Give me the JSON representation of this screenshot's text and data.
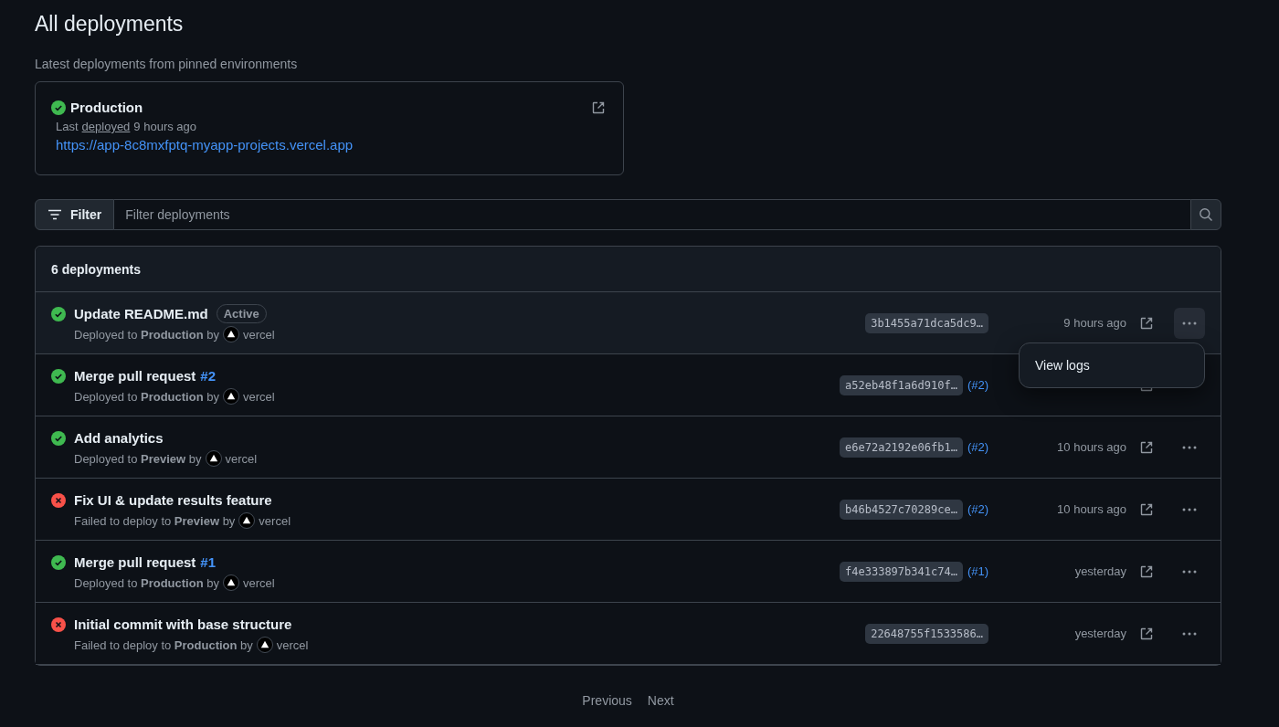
{
  "title": "All deployments",
  "pinned": {
    "heading": "Latest deployments from pinned environments",
    "environment": "Production",
    "kind": "success",
    "last_prefix": "Last",
    "last_link": "deployed",
    "last_time": "9 hours ago",
    "url": "https://app-8c8mxfptq-myapp-projects.vercel.app"
  },
  "filter": {
    "button": "Filter",
    "placeholder": "Filter deployments"
  },
  "list": {
    "count": "6 deployments",
    "rows": [
      {
        "kind": "success",
        "title": "Update README.md",
        "badge": "Active",
        "detail": "Deployed to **Production** by",
        "user": "vercel",
        "sha": "3b1455a71dca5dc9…",
        "time": "9 hours ago",
        "selected": true,
        "menu": [
          "View logs"
        ]
      },
      {
        "kind": "success",
        "title": "Merge pull request",
        "title_ref": "#2",
        "detail": "Deployed to **Production** by",
        "user": "vercel",
        "sha": "a52eb48f1a6d910f…",
        "pr": "(#2)",
        "selected": false,
        "menu": []
      },
      {
        "kind": "success",
        "title": "Add analytics",
        "detail": "Deployed to **Preview** by",
        "user": "vercel",
        "sha": "e6e72a2192e06fb1…",
        "pr": "(#2)",
        "time": "10 hours ago",
        "selected": false,
        "menu": []
      },
      {
        "kind": "failure",
        "title": "Fix UI & update results feature",
        "detail": "Failed to deploy to **Preview** by",
        "user": "vercel",
        "sha": "b46b4527c70289ce…",
        "pr": "(#2)",
        "time": "10 hours ago",
        "selected": false,
        "menu": []
      },
      {
        "kind": "success",
        "title": "Merge pull request",
        "title_ref": "#1",
        "detail": "Deployed to **Production** by",
        "user": "vercel",
        "sha": "f4e333897b341c74…",
        "pr": "(#1)",
        "time": "yesterday",
        "selected": false,
        "menu": []
      },
      {
        "kind": "failure",
        "title": "Initial commit with base structure",
        "detail": "Failed to deploy to **Production** by",
        "user": "vercel",
        "sha": "22648755f1533586…",
        "time": "yesterday",
        "selected": false,
        "menu": []
      }
    ]
  },
  "pagination": {
    "previous": "Previous",
    "next": "Next"
  }
}
